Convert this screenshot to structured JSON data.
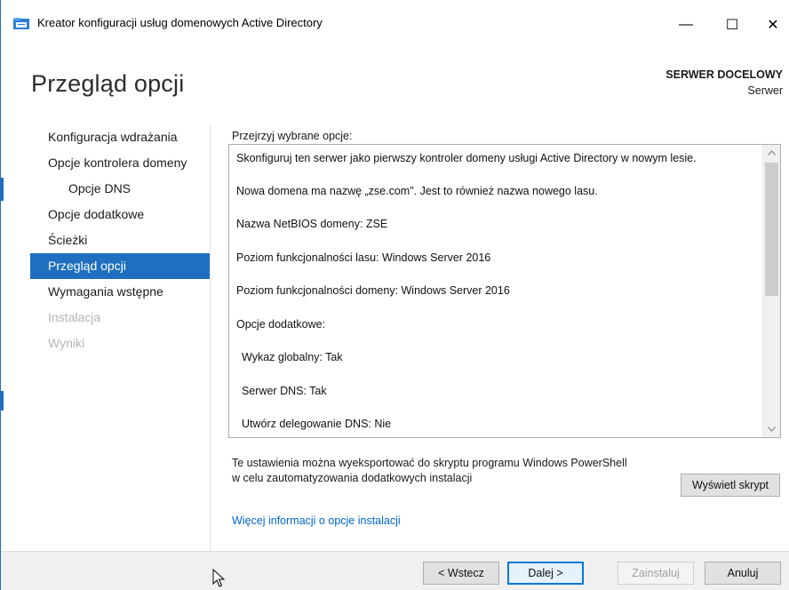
{
  "window": {
    "title": "Kreator konfiguracji usług domenowych Active Directory",
    "minimize_glyph": "—",
    "maximize_glyph": "☐",
    "close_glyph": "✕"
  },
  "header": {
    "page_title": "Przegląd opcji",
    "target_server_caption": "SERWER DOCELOWY",
    "target_server_name": "Serwer"
  },
  "nav": {
    "items": [
      {
        "label": "Konfiguracja wdrażania",
        "state": "normal"
      },
      {
        "label": "Opcje kontrolera domeny",
        "state": "normal"
      },
      {
        "label": "Opcje DNS",
        "state": "normal"
      },
      {
        "label": "Opcje dodatkowe",
        "state": "normal"
      },
      {
        "label": "Ścieżki",
        "state": "normal"
      },
      {
        "label": "Przegląd opcji",
        "state": "active"
      },
      {
        "label": "Wymagania wstępne",
        "state": "normal"
      },
      {
        "label": "Instalacja",
        "state": "disabled"
      },
      {
        "label": "Wyniki",
        "state": "disabled"
      }
    ]
  },
  "content": {
    "review_caption": "Przejrzyj wybrane opcje:",
    "review_lines": [
      "Skonfiguruj ten serwer jako pierwszy kontroler domeny usługi Active Directory w nowym lesie.",
      "Nowa domena ma nazwę „zse.com\". Jest to również nazwa nowego lasu.",
      "Nazwa NetBIOS domeny: ZSE",
      "Poziom funkcjonalności lasu: Windows Server 2016",
      "Poziom funkcjonalności domeny: Windows Server 2016",
      "Opcje dodatkowe:",
      "Wykaz globalny: Tak",
      "Serwer DNS: Tak",
      "Utwórz delegowanie DNS: Nie"
    ],
    "export_text_line1": "Te ustawienia można wyeksportować do skryptu programu Windows PowerShell",
    "export_text_line2": "w celu zautomatyzowania dodatkowych instalacji",
    "view_script_button": "Wyświetl skrypt",
    "more_info_link": "Więcej informacji o opcje instalacji"
  },
  "footer": {
    "back_button": "< Wstecz",
    "next_button": "Dalej >",
    "install_button": "Zainstaluj",
    "cancel_button": "Anuluj"
  },
  "colors": {
    "accent": "#1e6fbf",
    "link": "#0066cc",
    "disabled_text": "#b4b4b4"
  }
}
